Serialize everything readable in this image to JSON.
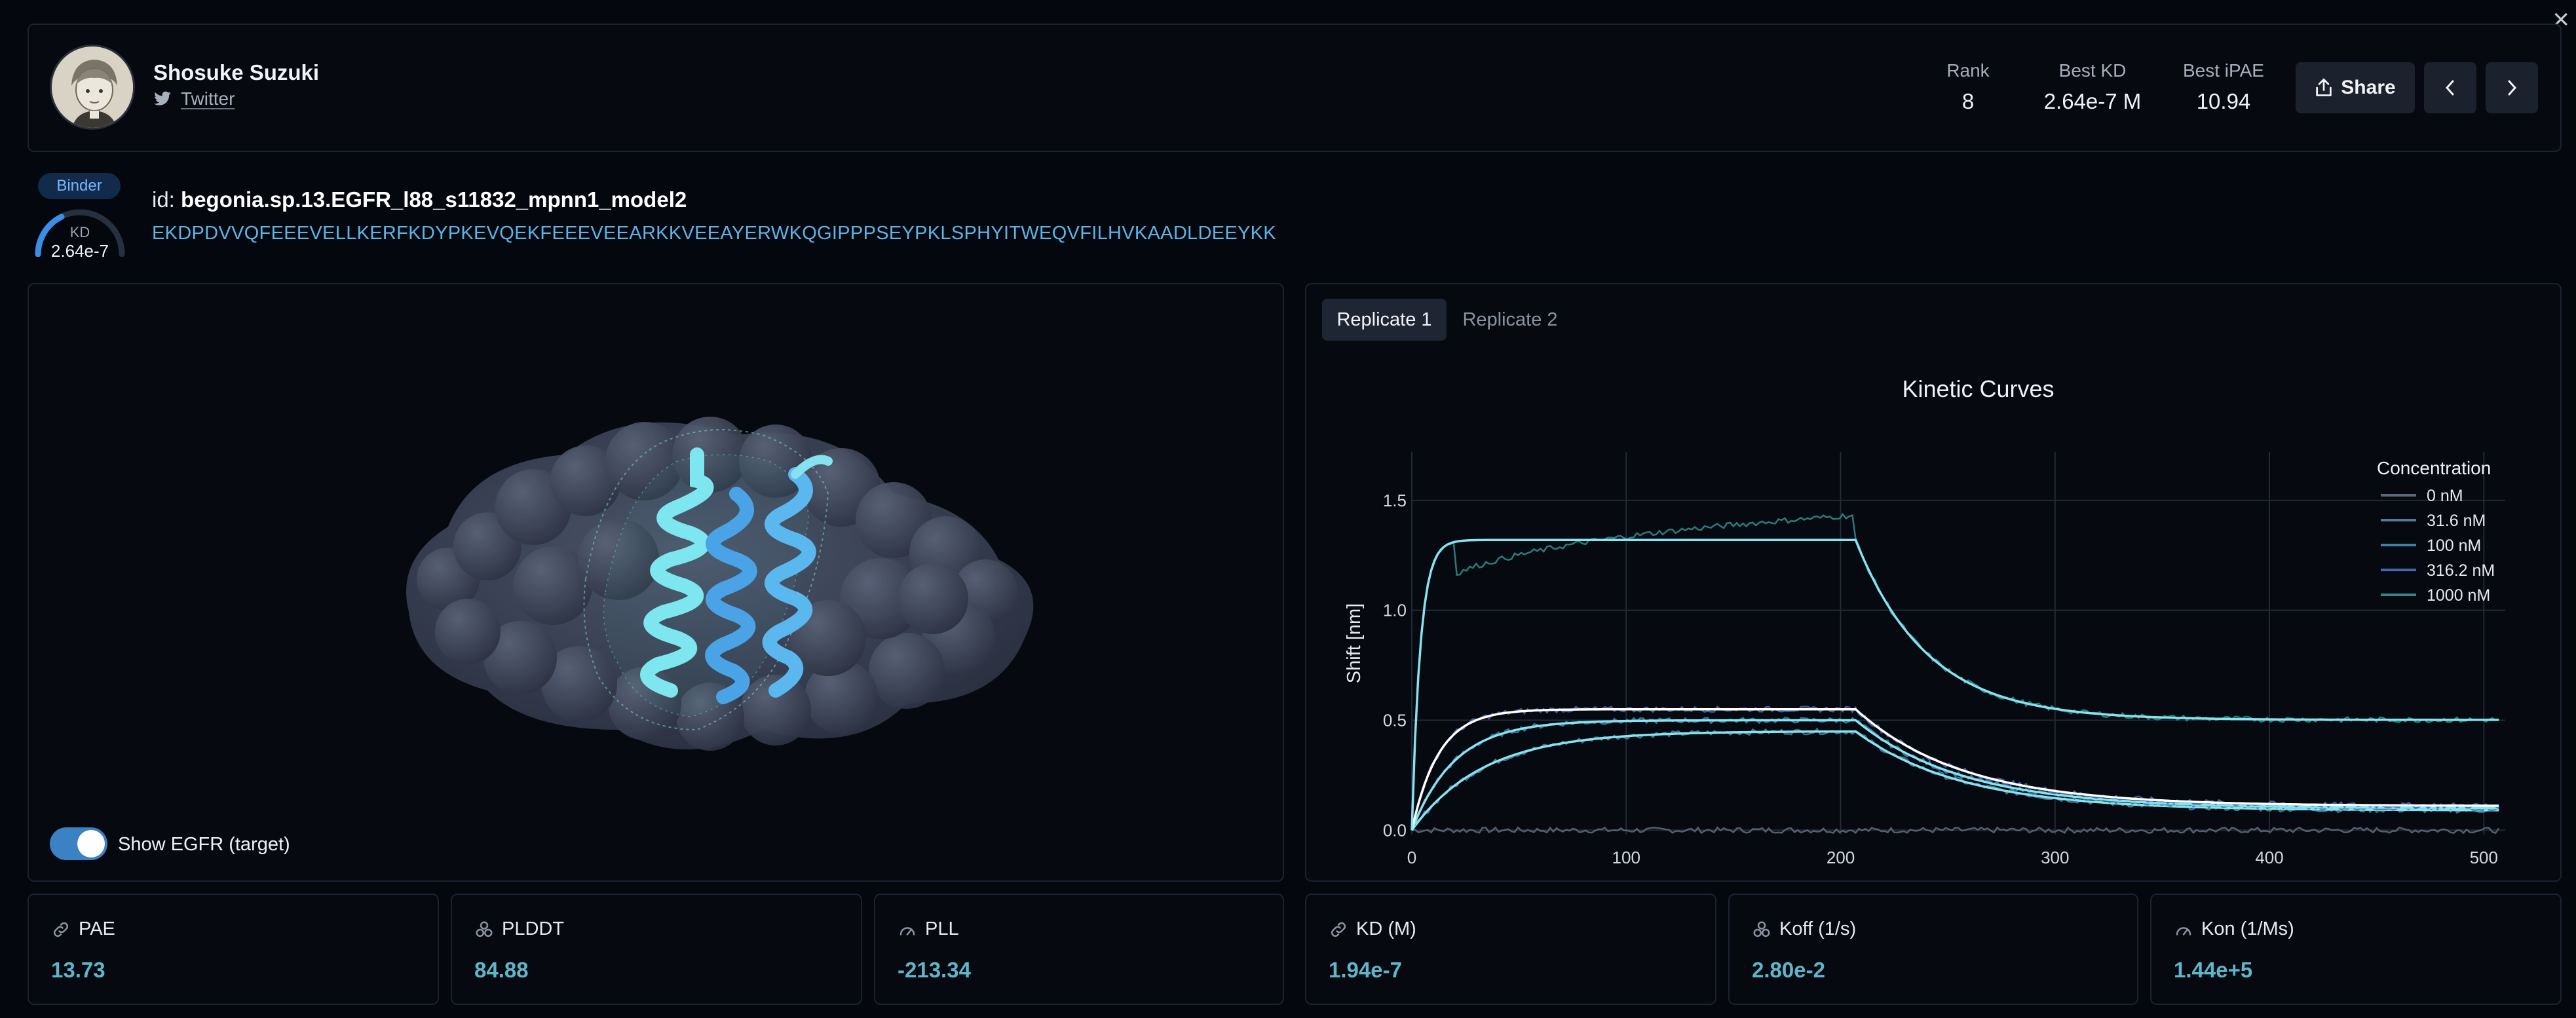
{
  "header": {
    "user_name": "Shosuke Suzuki",
    "twitter_label": "Twitter",
    "stats": [
      {
        "label": "Rank",
        "value": "8"
      },
      {
        "label": "Best KD",
        "value": "2.64e-7 M"
      },
      {
        "label": "Best iPAE",
        "value": "10.94"
      }
    ],
    "share_label": "Share"
  },
  "binder": {
    "badge": "Binder",
    "gauge_label": "KD",
    "gauge_value": "2.64e-7",
    "id_prefix": "id:",
    "id_value": "begonia.sp.13.EGFR_l88_s11832_mpnn1_model2",
    "sequence": "EKDPDVVQFEEEVELLKERFKDYPKEVQEKFEEEVEEARKKVEEAYERWKQGIPPPSEYPKLSPHYITWEQVFILHVKAADLDEEYKK"
  },
  "viewer": {
    "toggle_label": "Show EGFR (target)",
    "toggle_on": true
  },
  "tabs": [
    {
      "label": "Replicate 1",
      "active": true
    },
    {
      "label": "Replicate 2",
      "active": false
    }
  ],
  "chart_data": {
    "type": "line",
    "title": "Kinetic Curves",
    "xlabel": "",
    "ylabel": "Shift [nm]",
    "xlim": [
      0,
      510
    ],
    "ylim": [
      -0.02,
      1.72
    ],
    "xticks": [
      0,
      100,
      200,
      300,
      400,
      500
    ],
    "yticks": [
      0.0,
      0.5,
      1.0,
      1.5
    ],
    "grid": true,
    "legend_title": "Concentration",
    "legend_position": "top-right",
    "series": [
      {
        "name": "0 nM",
        "color": "#5a6b78",
        "plateau": 0.0,
        "kobs": 0.05,
        "koff": 0.02
      },
      {
        "name": "31.6 nM",
        "color": "#4f7c96",
        "plateau": 0.45,
        "kobs": 0.03,
        "koff": 0.02
      },
      {
        "name": "100 nM",
        "color": "#3f82a8",
        "plateau": 0.5,
        "kobs": 0.05,
        "koff": 0.02
      },
      {
        "name": "316.2 nM",
        "color": "#4468b4",
        "plateau": 0.55,
        "kobs": 0.08,
        "koff": 0.02
      },
      {
        "name": "1000 nM",
        "color": "#2f8a86",
        "plateau": 1.32,
        "kobs": 0.25,
        "koff": 0.03
      }
    ],
    "association_end": 207
  },
  "metrics": [
    {
      "label": "PAE",
      "value": "13.73",
      "icon": "link-icon"
    },
    {
      "label": "PLDDT",
      "value": "84.88",
      "icon": "cluster-icon"
    },
    {
      "label": "PLL",
      "value": "-213.34",
      "icon": "gauge-icon"
    },
    {
      "label": "KD (M)",
      "value": "1.94e-7",
      "icon": "link-icon"
    },
    {
      "label": "Koff (1/s)",
      "value": "2.80e-2",
      "icon": "cluster-icon"
    },
    {
      "label": "Kon (1/Ms)",
      "value": "1.44e+5",
      "icon": "gauge-icon"
    }
  ]
}
